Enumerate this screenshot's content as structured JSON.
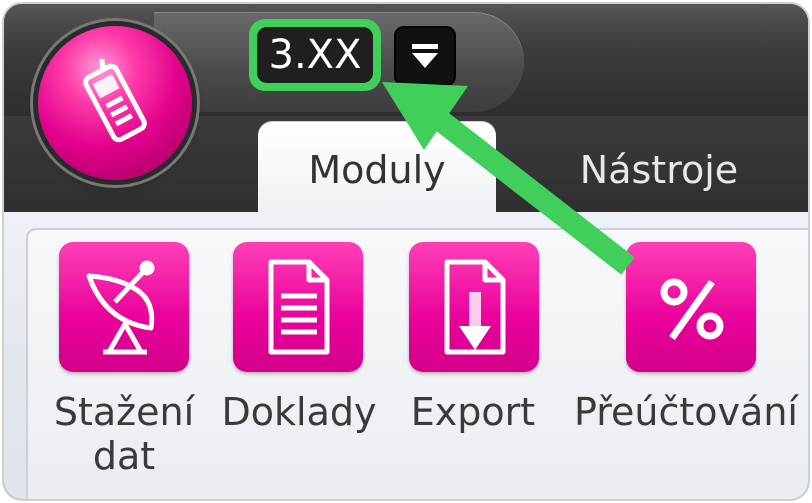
{
  "qat": {
    "version_label": "3.XX"
  },
  "tabs": [
    {
      "label": "Moduly"
    },
    {
      "label": "Nástroje"
    }
  ],
  "ribbon": {
    "buttons": [
      {
        "label_line1": "Stažení",
        "label_line2": "dat",
        "icon": "satellite-dish-icon"
      },
      {
        "label_line1": "Doklady",
        "icon": "document-icon"
      },
      {
        "label_line1": "Export",
        "icon": "export-document-icon"
      },
      {
        "label_line1": "Přeúčtování",
        "icon": "percent-icon"
      }
    ]
  },
  "colors": {
    "accent_magenta": "#e8009a",
    "highlight_green": "#3fcf5a",
    "title_dark": "#3b3b3b"
  },
  "icons": {
    "app_orb": "mobile-phone-icon",
    "qat_dropdown": "down-arrow-icon",
    "annotation": "green-arrow-icon"
  }
}
